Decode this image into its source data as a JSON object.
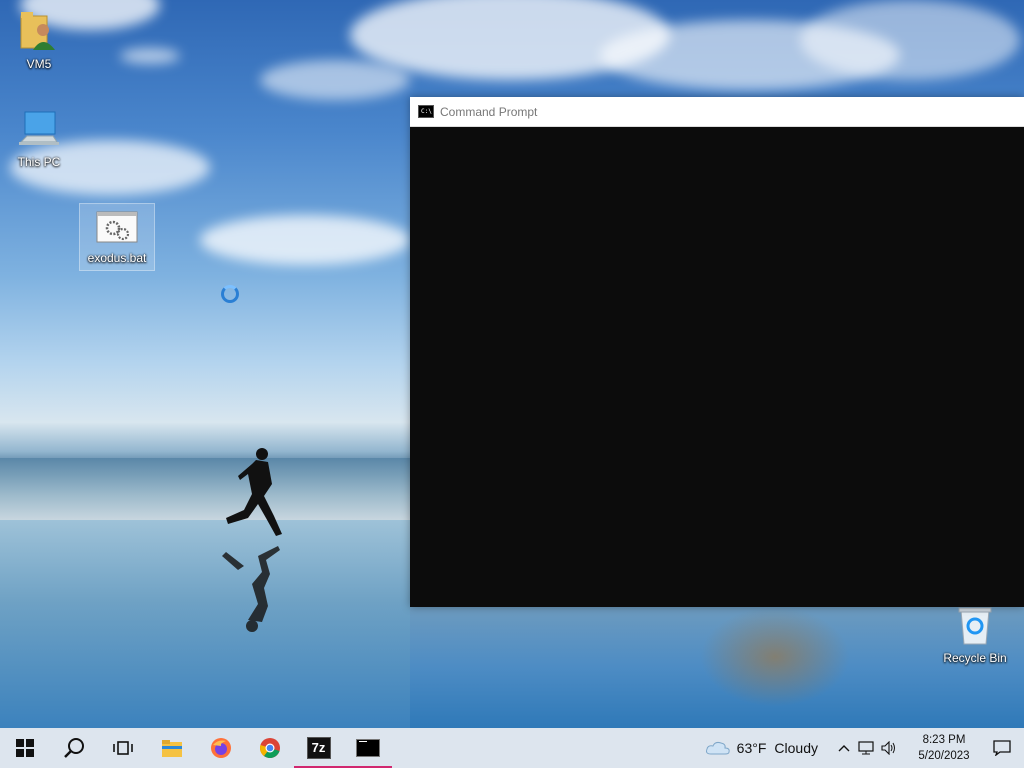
{
  "desktop": {
    "icons": [
      {
        "label": "VM5"
      },
      {
        "label": "This PC"
      },
      {
        "label": "exodus.bat"
      },
      {
        "label": "Recycle Bin"
      }
    ]
  },
  "cmd_window": {
    "title": "Command Prompt"
  },
  "taskbar": {
    "apps": [
      "start-icon",
      "search-icon",
      "task-view-icon",
      "file-explorer-icon",
      "firefox-icon",
      "chrome-icon",
      "7zip-icon",
      "command-prompt-icon"
    ],
    "weather": {
      "temp": "63°F",
      "condition": "Cloudy"
    },
    "clock": {
      "time": "8:23 PM",
      "date": "5/20/2023"
    }
  }
}
